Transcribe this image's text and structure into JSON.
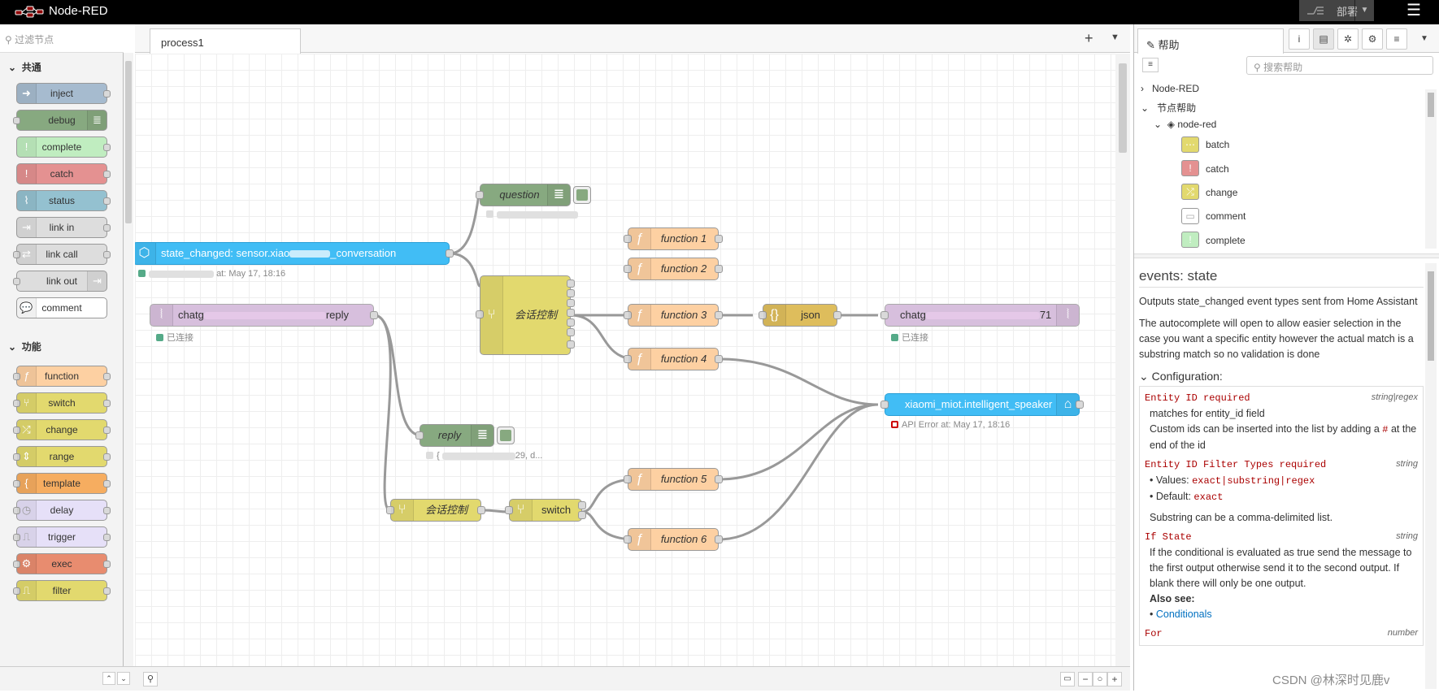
{
  "header": {
    "app_name": "Node-RED",
    "deploy_label": "部署"
  },
  "palette": {
    "search_placeholder": "过滤节点",
    "categories": [
      {
        "name": "共通",
        "nodes": [
          "inject",
          "debug",
          "complete",
          "catch",
          "status",
          "link in",
          "link call",
          "link out",
          "comment"
        ]
      },
      {
        "name": "功能",
        "nodes": [
          "function",
          "switch",
          "change",
          "range",
          "template",
          "delay",
          "trigger",
          "exec",
          "filter"
        ]
      }
    ]
  },
  "workspace": {
    "tab_label": "process1",
    "nodes": {
      "question": "question",
      "state_changed": "state_changed: sensor.xiao",
      "state_changed_tail": "_conversation",
      "state_changed_status": "at: May 17, 18:16",
      "session_ctrl": "会话控制",
      "chat_left": "chatg",
      "chat_left_tail": "reply",
      "chat_left_status": "已连接",
      "function1": "function 1",
      "function2": "function 2",
      "function3": "function 3",
      "function4": "function 4",
      "function5": "function 5",
      "function6": "function 6",
      "json": "json",
      "chat_right": "chatg",
      "chat_right_tail": "71",
      "chat_right_status": "已连接",
      "xiaomi": "xiaomi_miot.intelligent_speaker",
      "xiaomi_status": "API Error at: May 17, 18:16",
      "reply": "reply",
      "reply_status_tail": "29, d...",
      "session_ctrl2": "会话控制",
      "switch": "switch"
    }
  },
  "sidebar": {
    "tab_label": "帮助",
    "search_placeholder": "搜索帮助",
    "tree": {
      "root": "Node-RED",
      "section": "节点帮助",
      "module": "node-red",
      "nodes": [
        "batch",
        "catch",
        "change",
        "comment",
        "complete"
      ]
    },
    "help": {
      "title": "events: state",
      "p1": "Outputs state_changed event types sent from Home Assistant",
      "p2": "The autocomplete will open to allow easier selection in the case you want a specific entity however the actual match is a substring match so no validation is done",
      "config_heading": "Configuration:",
      "prop1_name": "Entity ID required",
      "prop1_type": "string|regex",
      "prop1_d1": "matches for entity_id field",
      "prop1_d2a": "Custom ids can be inserted into the list by adding a ",
      "prop1_d2code": "#",
      "prop1_d2b": " at the end of the id",
      "prop2_name": "Entity ID Filter Types required",
      "prop2_type": "string",
      "prop2_values_label": "Values: ",
      "prop2_values": "exact|substring|regex",
      "prop2_default_label": "Default: ",
      "prop2_default": "exact",
      "prop2_note": "Substring can be a comma-delimited list.",
      "prop3_name": "If State",
      "prop3_type": "string",
      "prop3_desc": "If the conditional is evaluated as true send the message to the first output otherwise send it to the second output. If blank there will only be one output.",
      "also_see": "Also see:",
      "link": "Conditionals",
      "prop4_name": "For",
      "prop4_type": "number"
    }
  },
  "watermark": "CSDN @林深时见鹿v",
  "colors": {
    "header": "#000000",
    "inject": "#a6bbcf",
    "debug": "#87a980",
    "complete": "#c0edc0",
    "catch": "#e49191",
    "status": "#94c1d0",
    "link": "#dddddd",
    "function": "#fdd0a2",
    "switch": "#e2d96e",
    "json": "#debd5c",
    "ha_blue": "#41bdf5",
    "websocket": "#d7d7a0",
    "exec": "#e88c6f",
    "template": "#f6ad60",
    "delay": "#e6e0f8"
  }
}
